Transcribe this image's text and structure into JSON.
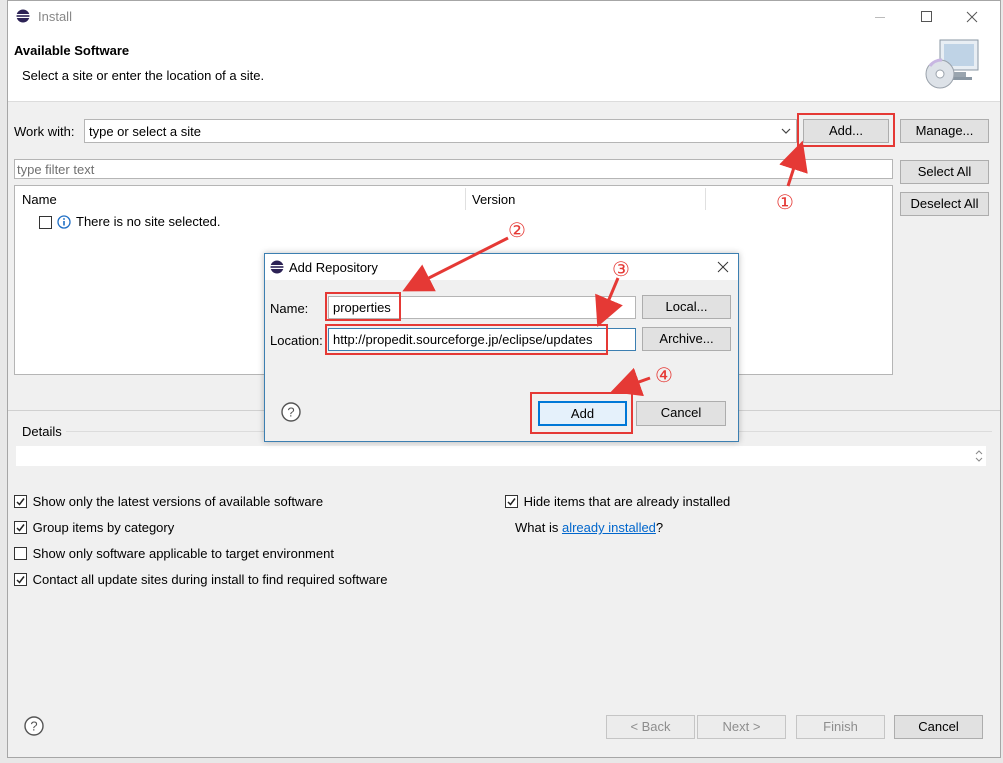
{
  "window": {
    "title": "Install",
    "header_title": "Available Software",
    "header_subtitle": "Select a site or enter the location of a site."
  },
  "work_with": {
    "label": "Work with:",
    "value": "type or select a site",
    "add_button": "Add...",
    "manage_button": "Manage..."
  },
  "filter": {
    "placeholder": "type filter text",
    "select_all": "Select All",
    "deselect_all": "Deselect All"
  },
  "table": {
    "columns": [
      "Name",
      "Version"
    ],
    "empty_message": "There is no site selected."
  },
  "details": {
    "label": "Details"
  },
  "options": [
    {
      "label": "Show only the latest versions of available software",
      "checked": true
    },
    {
      "label": "Group items by category",
      "checked": true
    },
    {
      "label": "Show only software applicable to target environment",
      "checked": false
    },
    {
      "label": "Contact all update sites during install to find required software",
      "checked": true
    },
    {
      "label": "Hide items that are already installed",
      "checked": true
    }
  ],
  "installed_info": {
    "prefix": "What is ",
    "link": "already installed",
    "suffix": "?"
  },
  "footer": {
    "back": "< Back",
    "next": "Next >",
    "finish": "Finish",
    "cancel": "Cancel"
  },
  "dialog": {
    "title": "Add Repository",
    "name_label": "Name:",
    "name_value": "properties",
    "location_label": "Location:",
    "location_value": "http://propedit.sourceforge.jp/eclipse/updates",
    "local_button": "Local...",
    "archive_button": "Archive...",
    "add_button": "Add",
    "cancel_button": "Cancel"
  },
  "annotations": [
    "①",
    "②",
    "③",
    "④"
  ],
  "colors": {
    "annotation": "#e53935",
    "link": "#0066cc",
    "dialog_border": "#3c7fb1"
  }
}
